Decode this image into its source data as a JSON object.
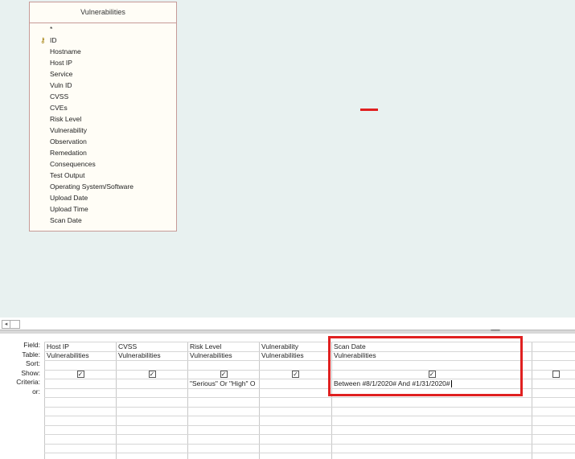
{
  "table": {
    "title": "Vulnerabilities",
    "fields": [
      "*",
      "ID",
      "Hostname",
      "Host IP",
      "Service",
      "Vuln ID",
      "CVSS",
      "CVEs",
      "Risk Level",
      "Vulnerability",
      "Observation",
      "Remedation",
      "Consequences",
      "Test Output",
      "Operating System/Software",
      "Upload Date",
      "Upload Time",
      "Scan Date"
    ],
    "primary_key_icon": "key-icon"
  },
  "grid": {
    "row_labels": {
      "field": "Field:",
      "table": "Table:",
      "sort": "Sort:",
      "show": "Show:",
      "criteria": "Criteria:",
      "or": "or:"
    },
    "columns": [
      {
        "field": "Host IP",
        "table": "Vulnerabilities",
        "show": true,
        "criteria": ""
      },
      {
        "field": "CVSS",
        "table": "Vulnerabilities",
        "show": true,
        "criteria": ""
      },
      {
        "field": "Risk Level",
        "table": "Vulnerabilities",
        "show": true,
        "criteria": "\"Serious\" Or \"High\" O"
      },
      {
        "field": "Vulnerability",
        "table": "Vulnerabilities",
        "show": true,
        "criteria": ""
      },
      {
        "field": "Scan Date",
        "table": "Vulnerabilities",
        "show": true,
        "criteria": "Between #8/1/2020# And #1/31/2020#"
      },
      {
        "field": "",
        "table": "",
        "show": false,
        "criteria": ""
      }
    ]
  },
  "colors": {
    "highlight": "#e02020",
    "canvas_bg": "#e8f1f0"
  }
}
